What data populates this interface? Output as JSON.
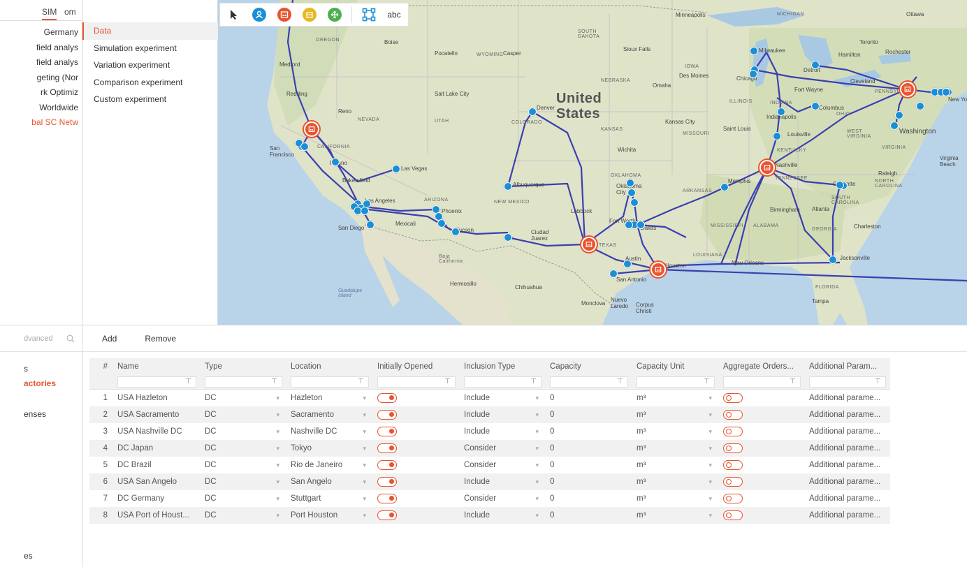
{
  "left_panel": {
    "tabs": [
      "SIM",
      "om"
    ],
    "projects": [
      {
        "label": "Germany",
        "active": false
      },
      {
        "label": "field analys",
        "active": false
      },
      {
        "label": "field analys",
        "active": false
      },
      {
        "label": "geting (Nor",
        "active": false
      },
      {
        "label": "rk Optimiz",
        "active": false
      },
      {
        "label": "Worldwide",
        "active": false
      },
      {
        "label": "bal SC Netw",
        "active": true
      }
    ]
  },
  "experiments": [
    {
      "label": "Data",
      "selected": true
    },
    {
      "label": "Simulation experiment",
      "selected": false
    },
    {
      "label": "Variation experiment",
      "selected": false
    },
    {
      "label": "Comparison experiment",
      "selected": false
    },
    {
      "label": "Custom experiment",
      "selected": false
    }
  ],
  "map": {
    "toolbar": {
      "tools": [
        {
          "name": "pointer-icon"
        },
        {
          "name": "customer-icon",
          "color": "#1a8fd6"
        },
        {
          "name": "factory-icon",
          "color": "#e8542f"
        },
        {
          "name": "warehouse-icon",
          "color": "#e8b820"
        },
        {
          "name": "supplier-icon",
          "color": "#4caf50"
        },
        {
          "name": "network-icon",
          "color": "#1a8fd6"
        }
      ],
      "text_tool": "abc"
    },
    "country_label": "United\nStates",
    "labels": {
      "ottawa": "Ottawa",
      "michigan": "MICHIGAN",
      "minneapolis": "Minneapolis",
      "oregon": "OREGON",
      "boise": "Boise",
      "pocatello": "Pocatello",
      "wyoming": "WYOMING",
      "casper": "Casper",
      "south_dakota": "SOUTH DAKOTA",
      "sioux_falls": "Sioux Falls",
      "nebraska": "NEBRASKA",
      "omaha": "Omaha",
      "des_moines": "Des Moines",
      "iowa": "IOWA",
      "milwaukee": "Milwaukee",
      "chicago": "Chicago",
      "detroit": "Detroit",
      "toronto": "Toronto",
      "hamilton": "Hamilton",
      "rochester": "Rochester",
      "cleveland": "Cleveland",
      "fort_wayne": "Fort Wayne",
      "pennsylvania": "PENNSYLVANIA",
      "new_york": "New York",
      "columbus": "Columbus",
      "illinois": "ILLINOIS",
      "indiana": "INDIANA",
      "indianapolis": "Indianapolis",
      "ohio": "OHIO",
      "washington": "Washington",
      "west_virginia": "WEST VIRGINIA",
      "virginia": "VIRGINIA",
      "virginia_beach": "Virginia Beach",
      "medford": "Medford",
      "redding": "Redding",
      "reno": "Reno",
      "nevada": "NEVADA",
      "salt_lake_city": "Salt Lake City",
      "utah": "UTAH",
      "denver": "Denver",
      "colorado": "COLORADO",
      "kansas": "KANSAS",
      "kansas_city": "Kansas City",
      "missouri": "MISSOURI",
      "saint_louis": "Saint Louis",
      "louisville": "Louisville",
      "kentucky": "KENTUCKY",
      "san_francisco": "San Francisco",
      "california": "CALIFORNIA",
      "fresno": "Fresno",
      "las_vegas": "Las Vegas",
      "bakersfield": "Bakersfield",
      "los_angeles": "Los Angeles",
      "san_diego": "San Diego",
      "wichita": "Wichita",
      "oklahoma": "OKLAHOMA",
      "oklahoma_city": "Oklahoma City",
      "nashville": "Nashville",
      "tennessee": "TENNESSEE",
      "memphis": "Memphis",
      "arkansas": "ARKANSAS",
      "raleigh": "Raleigh",
      "north_carolina": "NORTH CAROLINA",
      "south_carolina": "SOUTH CAROLINA",
      "charlotte": "Charlotte",
      "atlanta": "Atlanta",
      "birmingham": "Birmingham",
      "georgia": "GEORGIA",
      "charleston": "Charleston",
      "mississippi": "MISSISSIPPI",
      "alabama": "ALABAMA",
      "albuquerque": "Albuquerque",
      "new_mexico": "NEW MEXICO",
      "arizona": "ARIZONA",
      "phoenix": "Phoenix",
      "tucson": "Tucson",
      "lubbock": "Lubbock",
      "fort_worth": "Fort Worth",
      "dallas": "Dallas",
      "texas": "TEXAS",
      "austin": "Austin",
      "san_antonio": "San Antonio",
      "houston": "Houston",
      "louisiana": "LOUISIANA",
      "new_orleans": "New Orleans",
      "jacksonville": "Jacksonville",
      "florida": "FLORIDA",
      "tampa": "Tampa",
      "mexicali": "Mexicali",
      "ciudad_juarez": "Ciudad Juarez",
      "hermosillo": "Hermosillo",
      "chihuahua": "Chihuahua",
      "baja_california": "Baja California",
      "guadalupe_island": "Guadalupe Island",
      "nuevo_laredo": "Nuevo Laredo",
      "corpus_christi": "Corpus Christi",
      "monclova": "Monclova"
    }
  },
  "lower_left": {
    "search_placeholder": "dvanced",
    "nav": [
      {
        "label": "s",
        "active": false
      },
      {
        "label": "actories",
        "active": true
      },
      {
        "label": "enses",
        "active": false
      },
      {
        "label": "es",
        "active": false
      }
    ]
  },
  "table": {
    "toolbar": {
      "add": "Add",
      "remove": "Remove"
    },
    "columns": [
      "#",
      "Name",
      "Type",
      "Location",
      "Initially Opened",
      "Inclusion Type",
      "Capacity",
      "Capacity Unit",
      "Aggregate Orders...",
      "Additional Param..."
    ],
    "rows": [
      {
        "num": "1",
        "name": "USA Hazleton",
        "type": "DC",
        "location": "Hazleton",
        "opened": true,
        "inclusion": "Include",
        "capacity": "0",
        "unit": "m³",
        "aggregate": false,
        "additional": "Additional parame..."
      },
      {
        "num": "2",
        "name": "USA Sacramento",
        "type": "DC",
        "location": "Sacramento",
        "opened": true,
        "inclusion": "Include",
        "capacity": "0",
        "unit": "m³",
        "aggregate": false,
        "additional": "Additional parame..."
      },
      {
        "num": "3",
        "name": "USA Nashville DC",
        "type": "DC",
        "location": "Nashville DC",
        "opened": true,
        "inclusion": "Include",
        "capacity": "0",
        "unit": "m³",
        "aggregate": false,
        "additional": "Additional parame..."
      },
      {
        "num": "4",
        "name": "DC Japan",
        "type": "DC",
        "location": "Tokyo",
        "opened": true,
        "inclusion": "Consider",
        "capacity": "0",
        "unit": "m³",
        "aggregate": false,
        "additional": "Additional parame..."
      },
      {
        "num": "5",
        "name": "DC Brazil",
        "type": "DC",
        "location": "Rio de Janeiro",
        "opened": true,
        "inclusion": "Consider",
        "capacity": "0",
        "unit": "m³",
        "aggregate": false,
        "additional": "Additional parame..."
      },
      {
        "num": "6",
        "name": "USA San Angelo",
        "type": "DC",
        "location": "San Angelo",
        "opened": true,
        "inclusion": "Include",
        "capacity": "0",
        "unit": "m³",
        "aggregate": false,
        "additional": "Additional parame..."
      },
      {
        "num": "7",
        "name": "DC Germany",
        "type": "DC",
        "location": "Stuttgart",
        "opened": true,
        "inclusion": "Consider",
        "capacity": "0",
        "unit": "m³",
        "aggregate": false,
        "additional": "Additional parame..."
      },
      {
        "num": "8",
        "name": "USA Port of Houst...",
        "type": "DC",
        "location": "Port Houston",
        "opened": true,
        "inclusion": "Include",
        "capacity": "0",
        "unit": "m³",
        "aggregate": false,
        "additional": "Additional parame..."
      }
    ]
  },
  "colors": {
    "accent": "#e8542f",
    "route": "#3a3fb0",
    "customer": "#1a8fd6",
    "factory": "#e8542f"
  }
}
